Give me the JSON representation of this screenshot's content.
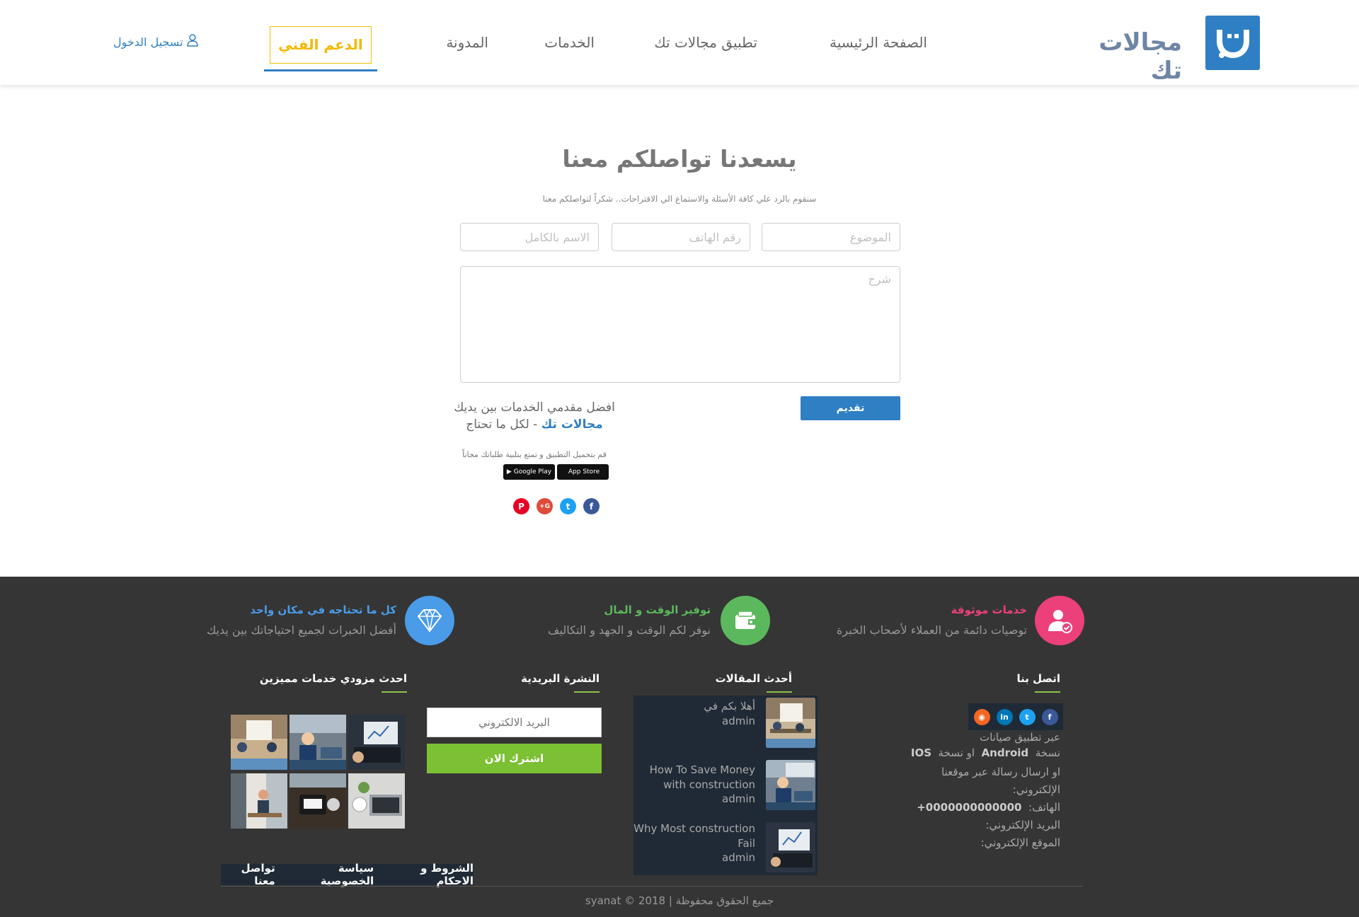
{
  "header": {
    "logo_text": "مجالات تك",
    "nav": {
      "home": "الصفحة الرئيسية",
      "app": "تطبيق مجالات تك",
      "services": "الخدمات",
      "blog": "المدونة",
      "support": "الدعم الفني"
    },
    "login": "تسجيل الدخول"
  },
  "contact": {
    "title": "يسعدنا تواصلكم معنا",
    "subtitle": "سنقوم بالرد علي كافة الأسئلة والاستماع الي الاقتراحات.. شكراً لتواصلكم معنا",
    "subject_placeholder": "الموضوع",
    "phone_placeholder": "رقم الهاتف",
    "name_placeholder": "الاسم بالكامل",
    "description_placeholder": "شرح",
    "submit_label": "تقديم"
  },
  "promo": {
    "line1": "افضل مقدمي الخدمات بين يديك",
    "brand": "مجالات تك",
    "line2_rest": " - لكل ما تحتاج",
    "download_text": "قم بتحميل التطبيق و تمتع بتلبية طلباتك مجاناً",
    "google_play": "Google Play",
    "app_store": "App Store"
  },
  "features": [
    {
      "title": "خدمات موثوقة",
      "desc": "توصيات دائمة من العملاء لأصحاب الخبرة",
      "color": "#ec407a",
      "icon": "user-check-icon"
    },
    {
      "title": "توفير الوقت و المال",
      "desc": "نوفر لكم الوقت و الجهد و التكاليف",
      "color": "#5cb85c",
      "icon": "wallet-icon"
    },
    {
      "title": "كل ما تحتاجه في مكان واحد",
      "desc": "أفضل الخبرات لجميع احتياجاتك بين يديك",
      "color": "#4a9be8",
      "icon": "diamond-icon"
    }
  ],
  "footer": {
    "contact_title": "اتصل بنا",
    "contact_lines": {
      "l1": "عبر تطبيق صيانات",
      "l2a": "نسخة",
      "android": "Android",
      "l2b": "او نسخة",
      "ios": "IOS",
      "l3": "او ارسال رسالة عبر موقعنا",
      "l4": "الإلكتروني:",
      "phone_label": "الهاتف:",
      "phone_value": "+0000000000000",
      "email_label": "البريد الإلكتروني:",
      "site_label": "الموقع الإلكتروني:"
    },
    "posts_title": "أحدث المقالات",
    "posts": [
      {
        "title": "أهلا بكم في",
        "author": "admin"
      },
      {
        "title": "How To Save Money with construction",
        "author": "admin"
      },
      {
        "title": "Why Most construction Fail",
        "author": "admin"
      }
    ],
    "newsletter_title": "النشرة البريدية",
    "newsletter_placeholder": "البريد الالكتروني",
    "newsletter_button": "اشترك الان",
    "providers_title": "احدث مزودي خدمات مميزين",
    "links": {
      "terms": "الشروط و الاحكام",
      "privacy": "سياسة الخصوصية",
      "contact": "تواصل معنا"
    },
    "copyright": "جميع الحقوق محفوظة | 2018 © syanat"
  }
}
